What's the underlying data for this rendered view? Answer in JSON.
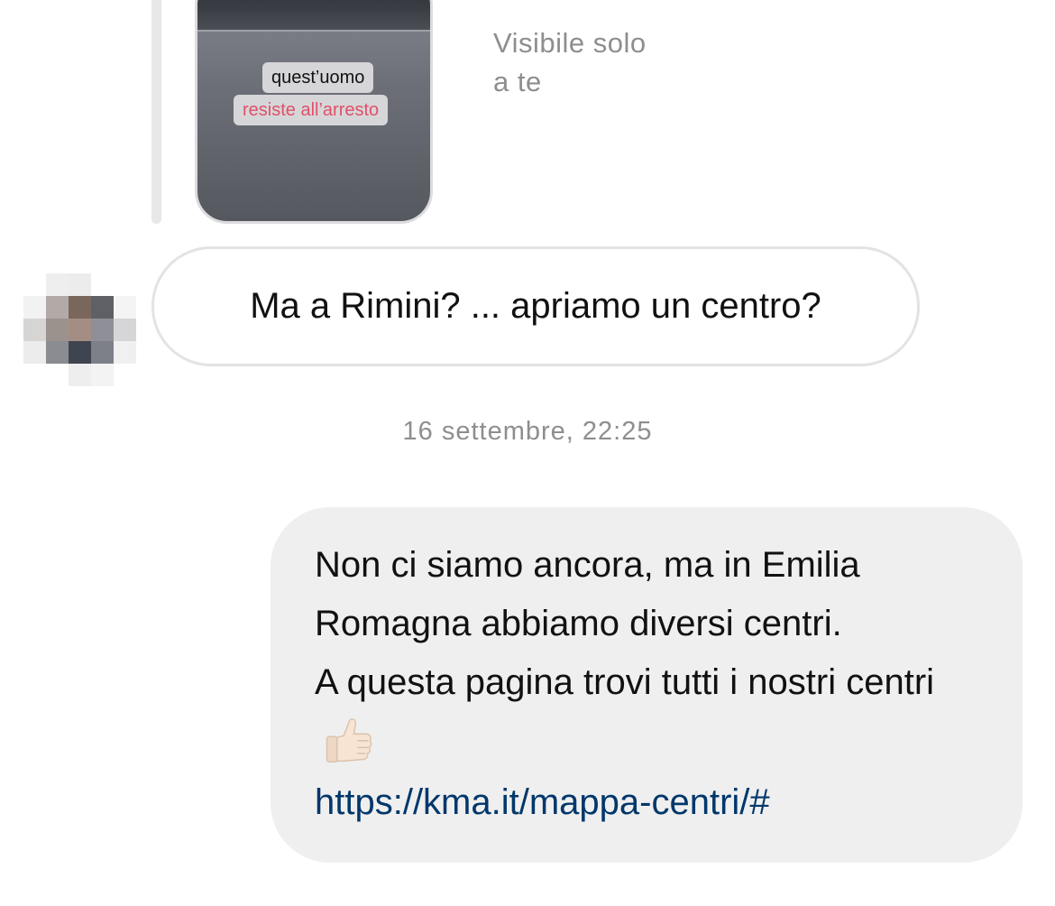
{
  "shared_story": {
    "sticker_line1": "quest’uomo",
    "sticker_line2": "resiste all’arresto",
    "visibility_line1": "Visibile solo",
    "visibility_line2": "a te"
  },
  "conversation": {
    "incoming_message": "Ma a Rimini? ... apriamo un centro?",
    "timestamp": "16 settembre, 22:25",
    "outgoing_message": {
      "paragraph1": "Non ci siamo ancora, ma in Emilia Romagna abbiamo diversi centri.",
      "paragraph2": "A questa pagina trovi tutti i nostri centri",
      "emoji": "thumbs-up",
      "link": "https://kma.it/mappa-centri/#"
    }
  },
  "colors": {
    "outgoing_bubble": "#efefef",
    "link": "#00376b",
    "meta_text": "#8e8e8e",
    "sticker_accent": "#e0506a"
  }
}
